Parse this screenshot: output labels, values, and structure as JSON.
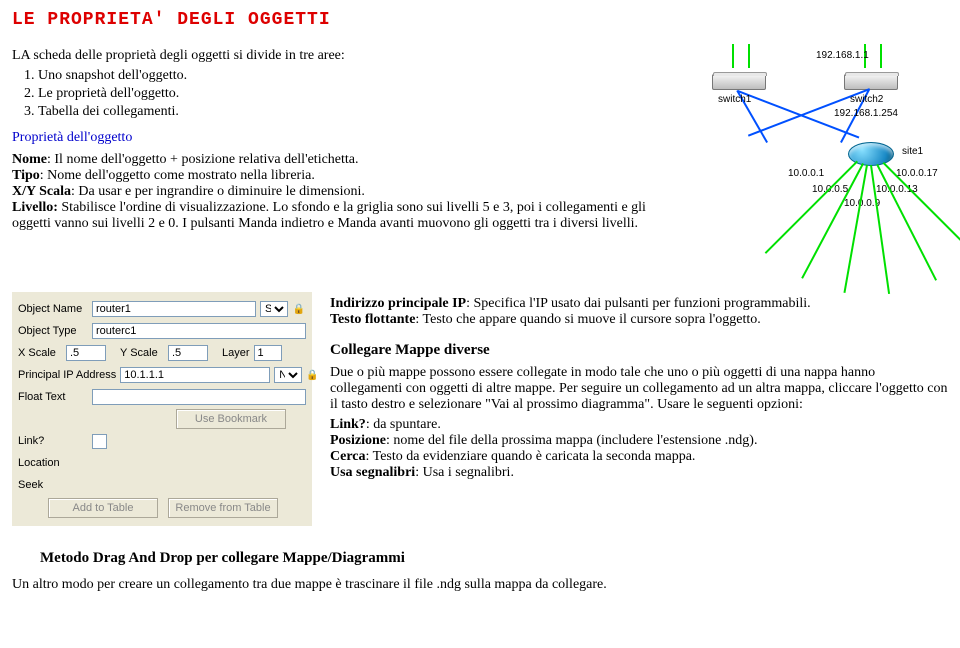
{
  "title": "LE PROPRIETA' DEGLI OGGETTI",
  "intro": "LA scheda delle proprietà degli oggetti si divide in tre aree:",
  "list": {
    "i1": "Uno snapshot dell'oggetto.",
    "i2": "Le proprietà dell'oggetto.",
    "i3": "Tabella dei collegamenti."
  },
  "sub": "Proprietà dell'oggetto",
  "props": {
    "name_b": "Nome",
    "name_t": ": Il nome dell'oggetto + posizione relativa dell'etichetta.",
    "type_b": "Tipo",
    "type_t": ": Nome dell'oggetto come mostrato nella libreria.",
    "scala_b": "X/Y Scala",
    "scala_t": ": Da usar e per ingrandire o diminuire le dimensioni.",
    "level_b": "Livello:",
    "level_t": " Stabilisce l'ordine di visualizzazione. Lo sfondo e la griglia sono sui livelli 5 e 3, poi i collegamenti e gli oggetti vanno sui livelli 2 e 0. I pulsanti Manda indietro e Manda avanti muovono gli oggetti tra i diversi livelli.",
    "ip_b": "Indirizzo principale IP",
    "ip_t": ": Specifica l'IP usato dai pulsanti per funzioni programmabili.",
    "flot_b": "Testo flottante",
    "flot_t": ": Testo che appare quando si muove il cursore sopra l'oggetto."
  },
  "collegare_h": "Collegare Mappe diverse",
  "collegare_p1": "Due o più mappe possono essere collegate in modo tale che uno o più oggetti di una nappa hanno collegamenti con oggetti di altre mappe. Per seguire un collegamento ad un altra mappa, cliccare l'oggetto con il tasto destro e selezionare \"Vai al prossimo diagramma\". Usare le seguenti opzioni:",
  "link_b": "Link?",
  "link_t": ": da spuntare.",
  "pos_b": "Posizione",
  "pos_t": ": nome del file della prossima mappa (includere l'estensione .ndg).",
  "cerca_b": "Cerca",
  "cerca_t": ": Testo da evidenziare quando è caricata la seconda mappa.",
  "seg_b": "Usa segnalibri",
  "seg_t": ": Usa i segnalibri.",
  "metodo_h": "Metodo  Drag And Drop per collegare Mappe/Diagrammi",
  "metodo_p": "Un altro modo per creare un collegamento tra due mappe è trascinare il file .ndg sulla mappa da collegare.",
  "diagram": {
    "ip_top": "192.168.1.1",
    "sw1": "switch1",
    "sw2": "switch2",
    "ip_gw": "192.168.1.254",
    "site": "site1",
    "ip1": "10.0.0.1",
    "ip17": "10.0.0.17",
    "ip5": "10.0.0.5",
    "ip13": "10.0.0.13",
    "ip9": "10.0.0.9"
  },
  "form": {
    "obj_name_lbl": "Object Name",
    "obj_name_val": "router1",
    "obj_type_lbl": "Object Type",
    "obj_type_val": "routerc1",
    "xscale_lbl": "X Scale",
    "xscale_val": ".5",
    "yscale_lbl": "Y Scale",
    "yscale_val": ".5",
    "layer_lbl": "Layer",
    "layer_val": "1",
    "pip_lbl": "Principal IP Address",
    "pip_val": "10.1.1.1",
    "float_lbl": "Float Text",
    "float_val": "",
    "use_bm": "Use Bookmark",
    "linkq": "Link?",
    "location": "Location",
    "seek": "Seek",
    "add": "Add to Table",
    "remove": "Remove from Table",
    "sel_s": "S",
    "sel_n": "N"
  }
}
